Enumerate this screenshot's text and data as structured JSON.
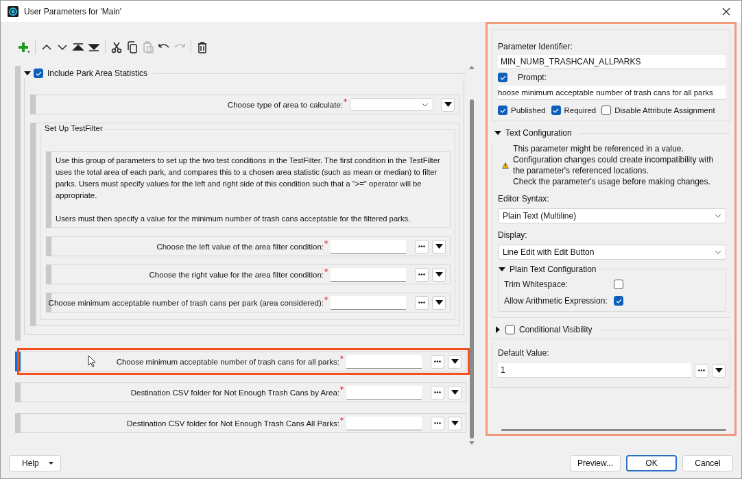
{
  "window": {
    "title": "User Parameters for 'Main'"
  },
  "toolbar": [
    {
      "kind": "add",
      "disabled": false
    },
    {
      "kind": "up",
      "disabled": false
    },
    {
      "kind": "down",
      "disabled": false
    },
    {
      "kind": "top",
      "disabled": false
    },
    {
      "kind": "bottom",
      "disabled": false
    },
    {
      "kind": "cut",
      "disabled": false
    },
    {
      "kind": "copy",
      "disabled": false
    },
    {
      "kind": "paste",
      "disabled": true
    },
    {
      "kind": "undo",
      "disabled": false
    },
    {
      "kind": "redo",
      "disabled": true
    },
    {
      "kind": "delete",
      "disabled": false
    }
  ],
  "parameters": [
    {
      "kind": "group",
      "label": "Include Park Area Statistics",
      "checked": true,
      "expanded": true,
      "children": [
        {
          "kind": "choice",
          "label": "Choose type of area to calculate:",
          "required": true,
          "selected": false
        },
        {
          "kind": "section",
          "label": "Set Up TestFilter",
          "children": [
            {
              "kind": "description",
              "text": "Use this group of parameters to set up the two test conditions in the TestFilter. The first condition in the TestFilter uses the total area of each park, and compares this to a chosen area statistic (such as mean or median) to filter parks. Users must specify values for the left and right side of this condition such that a \">=\" operator will be appropriate.\n\nUsers must then specify a value for the minimum number of trash cans acceptable for the filtered parks."
            },
            {
              "kind": "text",
              "label": "Choose the left value of the area filter condition:",
              "required": true,
              "selected": false
            },
            {
              "kind": "text",
              "label": "Choose the right value for the area filter condition:",
              "required": true,
              "selected": false
            },
            {
              "kind": "text",
              "label": "Choose minimum acceptable number of trash cans per park (area considered):",
              "required": true,
              "selected": false
            }
          ]
        }
      ]
    },
    {
      "kind": "text",
      "label": "Choose minimum acceptable number of trash cans for all parks:",
      "required": true,
      "selected": true
    },
    {
      "kind": "text",
      "label": "Destination CSV folder for Not Enough Trash Cans by Area:",
      "required": true,
      "selected": false
    },
    {
      "kind": "text",
      "label": "Destination CSV folder for Not Enough Trash Cans All Parks:",
      "required": true,
      "selected": false
    }
  ],
  "properties": {
    "identifier_label": "Parameter Identifier:",
    "identifier": "MIN_NUMB_TRASHCAN_ALLPARKS",
    "prompt": {
      "label": "Prompt:",
      "checked": true,
      "value": "hoose minimum acceptable number of trash cans for all parks"
    },
    "flags": [
      {
        "label": "Published",
        "checked": true
      },
      {
        "label": "Required",
        "checked": true
      },
      {
        "label": "Disable Attribute Assignment",
        "checked": false
      }
    ],
    "text_configuration": {
      "title": "Text Configuration",
      "expanded": true,
      "warning": "This parameter might be referenced in a value.\nConfiguration changes could create incompatibility with the parameter's referenced locations.\nCheck the parameter's usage before making changes.",
      "editor_syntax": {
        "label": "Editor Syntax:",
        "value": "Plain Text (Multiline)"
      },
      "display": {
        "label": "Display:",
        "value": "Line Edit with Edit Button"
      },
      "plain_text": {
        "title": "Plain Text Configuration",
        "expanded": true,
        "options": [
          {
            "label": "Trim Whitespace:",
            "checked": false
          },
          {
            "label": "Allow Arithmetic Expression:",
            "checked": true
          }
        ]
      }
    },
    "conditional_visibility": {
      "label": "Conditional Visibility",
      "expanded": false,
      "checked": false
    },
    "default_value": {
      "label": "Default Value:",
      "value": "1"
    }
  },
  "footer": {
    "help": "Help",
    "buttons": [
      {
        "label": "Preview...",
        "default": false
      },
      {
        "label": "OK",
        "default": true
      },
      {
        "label": "Cancel",
        "default": false
      }
    ]
  }
}
